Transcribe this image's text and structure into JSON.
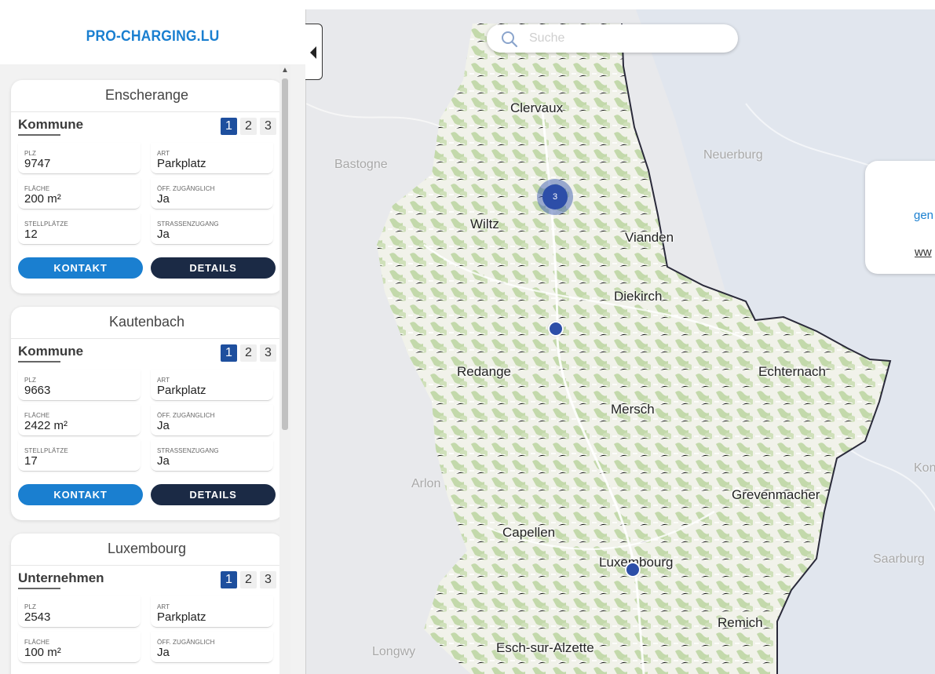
{
  "brand": "PRO-CHARGING.LU",
  "icons": {
    "scroll_up": "▲",
    "collapse": "collapse-left-triangle-icon",
    "search": "search-icon"
  },
  "field_labels": {
    "plz": "PLZ",
    "art": "ART",
    "flaeche": "FLÄCHE",
    "oeff": "ÖFF. ZUGÄNGLICH",
    "stellplaetze": "STELLPLÄTZE",
    "strassenzugang": "STRASSENZUGANG"
  },
  "buttons": {
    "kontakt": "KONTAKT",
    "details": "DETAILS"
  },
  "pages": [
    "1",
    "2",
    "3"
  ],
  "listings": [
    {
      "title": "Enscherange",
      "type": "Kommune",
      "plz": "9747",
      "art": "Parkplatz",
      "flaeche": "200 m²",
      "oeff": "Ja",
      "stellplaetze": "12",
      "strassenzugang": "Ja"
    },
    {
      "title": "Kautenbach",
      "type": "Kommune",
      "plz": "9663",
      "art": "Parkplatz",
      "flaeche": "2422 m²",
      "oeff": "Ja",
      "stellplaetze": "17",
      "strassenzugang": "Ja"
    },
    {
      "title": "Luxembourg",
      "type": "Unternehmen",
      "plz": "2543",
      "art": "Parkplatz",
      "flaeche": "100 m²",
      "oeff": "Ja"
    }
  ],
  "search": {
    "placeholder": "Suche"
  },
  "map": {
    "labels": {
      "clervaux": "Clervaux",
      "bastogne": "Bastogne",
      "neuerburg": "Neuerburg",
      "wiltz": "Wiltz",
      "vianden": "Vianden",
      "diekirch": "Diekirch",
      "redange": "Redange",
      "echternach": "Echternach",
      "mersch": "Mersch",
      "arlon": "Arlon",
      "konz": "Konz",
      "grevenmacher": "Grevenmacher",
      "capellen": "Capellen",
      "luxembourg": "Luxembourg",
      "saarburg": "Saarburg",
      "remich": "Remich",
      "longwy": "Longwy",
      "esch": "Esch-sur-Alzette"
    },
    "cluster_count": "3",
    "colors": {
      "land": "#e6e7e9",
      "country": "#f2f2ec",
      "forest": "#c6dbb0",
      "marker": "#2d4ea8",
      "border": "#2a2a3a"
    }
  },
  "popup": {
    "line1": "gen",
    "line2": "ww"
  }
}
